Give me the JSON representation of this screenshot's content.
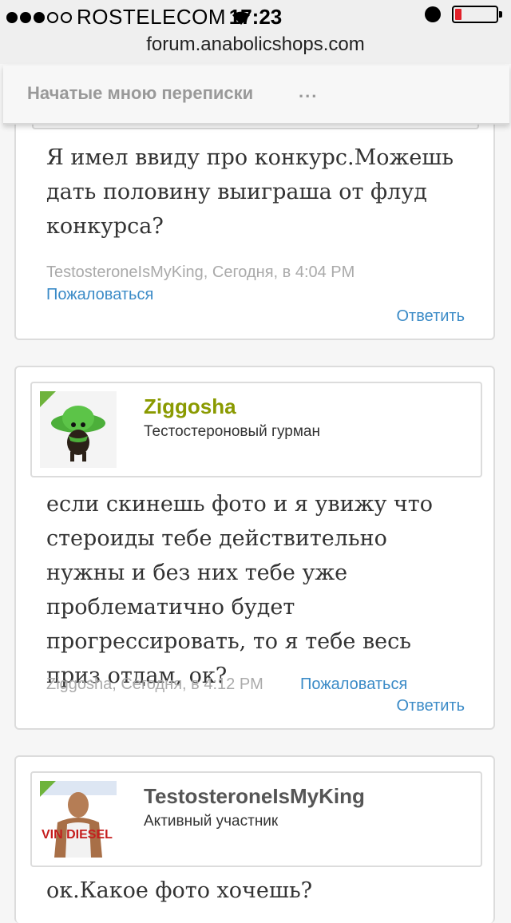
{
  "status_bar": {
    "carrier": "ROSTELECOM",
    "time": "17:23",
    "signal_bars_filled": 3,
    "signal_bars_total": 5,
    "battery_level": 0.15
  },
  "url_bar": {
    "url": "forum.anabolicshops.com"
  },
  "nav": {
    "title": "Начатые мною переписки",
    "more": "..."
  },
  "posts": [
    {
      "message": "Я имел ввиду про конкурс.Можешь дать половину выиграша от флуд конкурса?",
      "meta": "TestosteroneIsMyKing, Сегодня, в 4:04 PM",
      "report_label": "Пожаловаться",
      "reply_label": "Ответить"
    },
    {
      "username": "Ziggosha",
      "username_color": "#8a9a00",
      "role": "Тестостероновый гурман",
      "message": "если скинешь фото и я увижу что стероиды тебе действительно нужны и без них тебе уже проблематично будет прогрессировать, то я тебе весь приз отдам, ок?",
      "meta": "Ziggosha, Сегодня, в 4:12 PM",
      "report_label": "Пожаловаться",
      "reply_label": "Ответить"
    },
    {
      "username": "TestosteroneIsMyKing",
      "username_color": "#555555",
      "role": "Активный участник",
      "avatar_text": "VIN DIESEL",
      "message": "ок.Какое фото хочешь?"
    }
  ]
}
